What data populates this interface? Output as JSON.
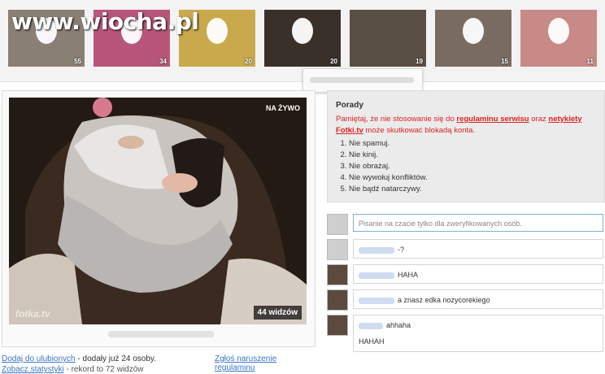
{
  "header": {
    "logo": "www.wiocha.pl"
  },
  "thumbnails": [
    {
      "count": "55",
      "color": "#8a7f75"
    },
    {
      "count": "34",
      "color": "#b8567a"
    },
    {
      "count": "20",
      "color": "#c9a94b"
    },
    {
      "count": "20",
      "color": "#3a302a"
    },
    {
      "count": "19",
      "color": "#5a4f45"
    },
    {
      "count": "15",
      "color": "#7a6b60"
    },
    {
      "count": "11",
      "color": "#c78a86"
    }
  ],
  "video": {
    "live_label": "NA ŻYWO",
    "viewers": "44 widzów",
    "watermark": "fotka.tv"
  },
  "links": {
    "favorite": "Dodaj do ulubionych",
    "favorite_suffix": " - dodały już 24 osoby.",
    "report": "Zgłoś naruszenie regulaminu",
    "stats": "Zobacz statystyki",
    "stats_suffix": " - rekord to 72 widzów"
  },
  "tips": {
    "title": "Porady",
    "warn_prefix": "Pamiętaj, że nie stosowanie się do ",
    "warn_link1": "regulaminu serwisu",
    "warn_mid": " oraz ",
    "warn_link2": "netykiety Fotki.tv",
    "warn_suffix": " może skutkować blokadą konta.",
    "rules": [
      "Nie spamuj.",
      "Nie kinij.",
      "Nie obrażaj.",
      "Nie wywołuj konfliktów.",
      "Nie bądź natarczywy."
    ]
  },
  "comment_input": {
    "placeholder": "Pisanie na czacie tylko dla zweryfikowanych osób."
  },
  "comments": [
    {
      "text": "-?"
    },
    {
      "text": "HAHA"
    },
    {
      "text": "a znasz edka nozycorekiego"
    },
    {
      "text": "ahhaha",
      "extra": "HAHAH"
    }
  ]
}
